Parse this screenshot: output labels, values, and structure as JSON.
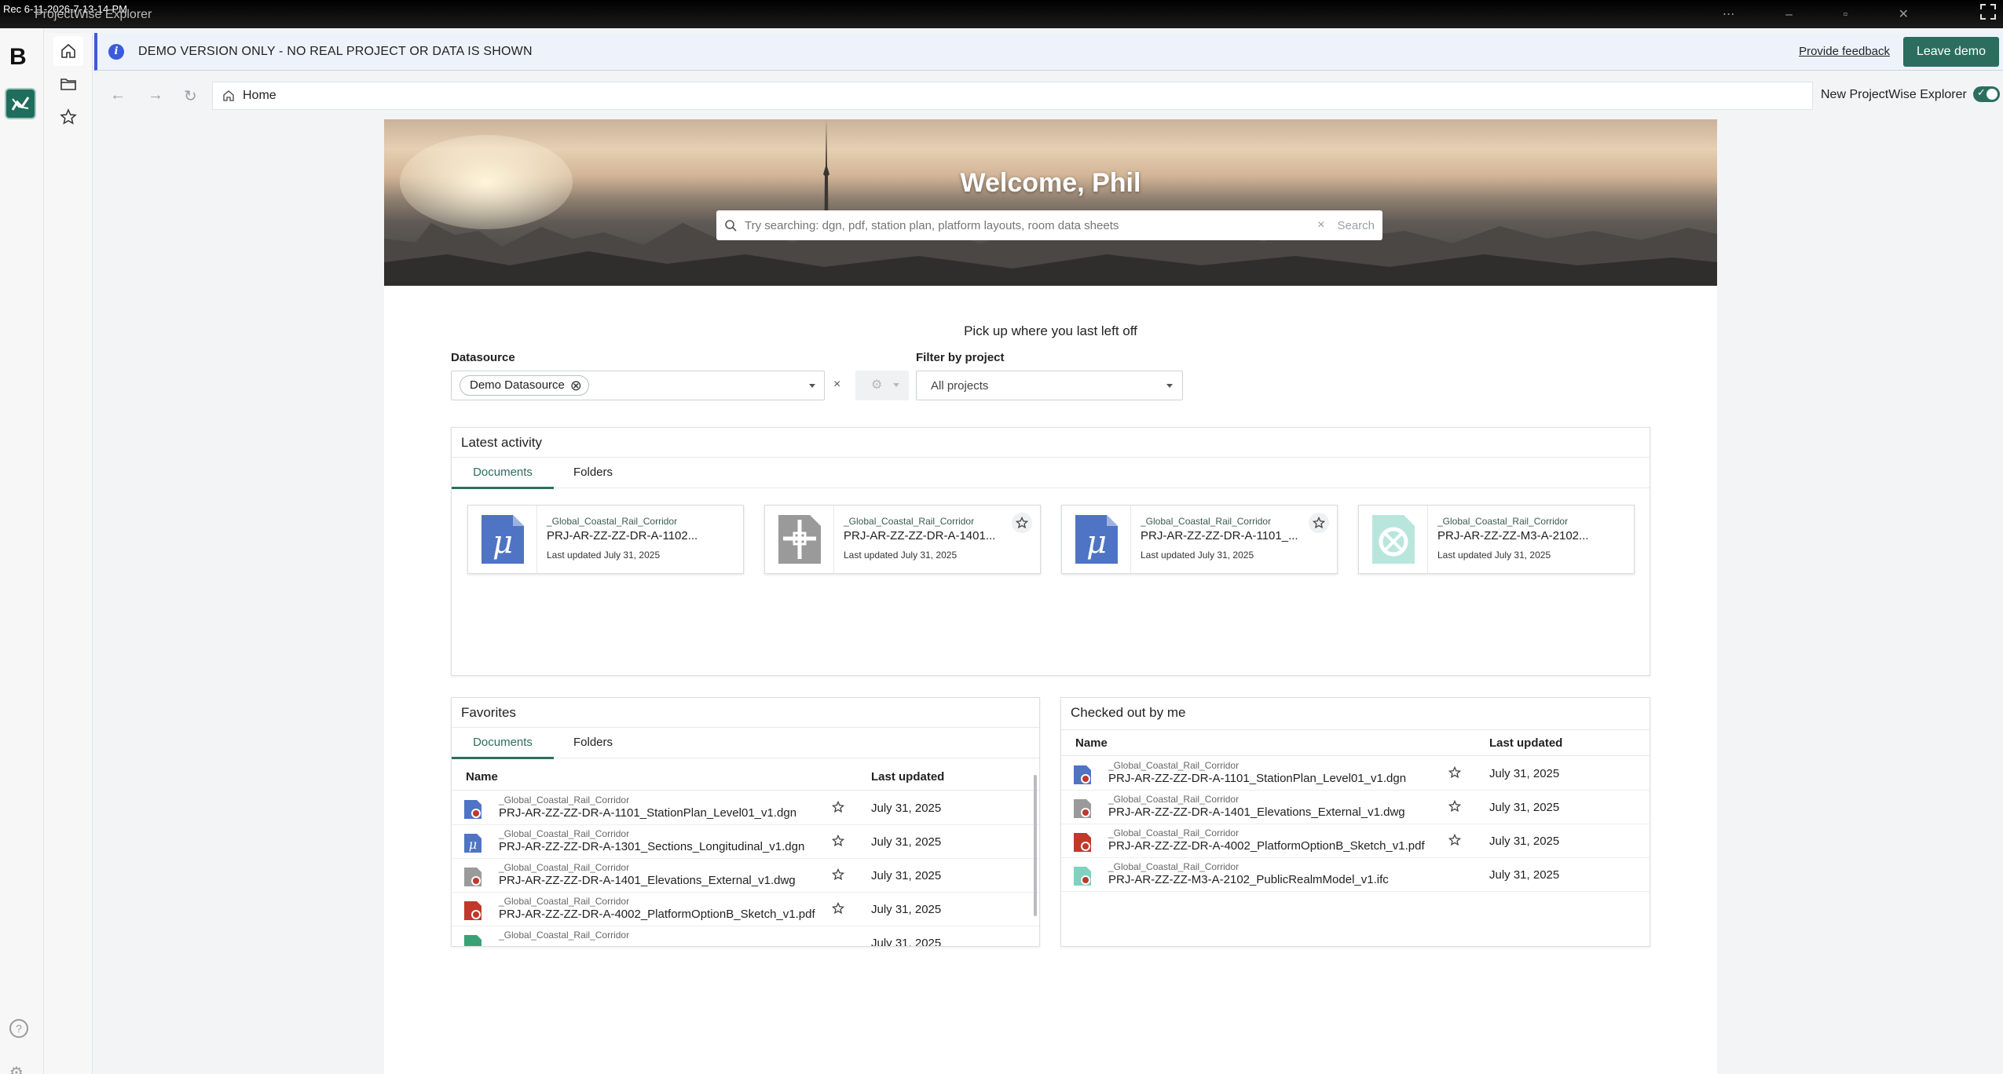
{
  "os": {
    "recording_label": "Rec 6-11-2026-7-13-14-PM",
    "window_title": "ProjectWise Explorer"
  },
  "rail": {
    "logo": "B"
  },
  "banner": {
    "message": "DEMO VERSION ONLY - NO REAL PROJECT OR DATA IS SHOWN",
    "feedback_link": "Provide feedback",
    "leave_button": "Leave demo"
  },
  "address": {
    "crumb": "Home",
    "new_explorer_label": "New ProjectWise Explorer",
    "new_explorer_on": true
  },
  "hero": {
    "welcome": "Welcome, Phil",
    "search_placeholder": "Try searching: dgn, pdf, station plan, platform layouts, room data sheets",
    "search_button": "Search"
  },
  "pickup_text": "Pick up where you last left off",
  "filters": {
    "datasource_label": "Datasource",
    "datasource_chip": "Demo Datasource",
    "project_label": "Filter by project",
    "project_value": "All projects"
  },
  "latest": {
    "title": "Latest activity",
    "tabs": [
      "Documents",
      "Folders"
    ],
    "cards": [
      {
        "path": "_Global_Coastal_Rail_Corridor",
        "name": "PRJ-AR-ZZ-ZZ-DR-A-1102...",
        "date": "Last updated July 31, 2025",
        "icon": "microstation-icon"
      },
      {
        "path": "_Global_Coastal_Rail_Corridor",
        "name": "PRJ-AR-ZZ-ZZ-DR-A-1401...",
        "date": "Last updated July 31, 2025",
        "icon": "dwg-icon"
      },
      {
        "path": "_Global_Coastal_Rail_Corridor",
        "name": "PRJ-AR-ZZ-ZZ-DR-A-1101_...",
        "date": "Last updated July 31, 2025",
        "icon": "microstation-icon"
      },
      {
        "path": "_Global_Coastal_Rail_Corridor",
        "name": "PRJ-AR-ZZ-ZZ-M3-A-2102...",
        "date": "Last updated July 31, 2025",
        "icon": "ifc-icon"
      }
    ]
  },
  "favorites": {
    "title": "Favorites",
    "tabs": [
      "Documents",
      "Folders"
    ],
    "col_name": "Name",
    "col_updated": "Last updated",
    "rows": [
      {
        "path": "_Global_Coastal_Rail_Corridor",
        "name": "PRJ-AR-ZZ-ZZ-DR-A-1101_StationPlan_Level01_v1.dgn",
        "date": "July 31, 2025",
        "icon": "dgn-checked-icon"
      },
      {
        "path": "_Global_Coastal_Rail_Corridor",
        "name": "PRJ-AR-ZZ-ZZ-DR-A-1301_Sections_Longitudinal_v1.dgn",
        "date": "July 31, 2025",
        "icon": "microstation-icon"
      },
      {
        "path": "_Global_Coastal_Rail_Corridor",
        "name": "PRJ-AR-ZZ-ZZ-DR-A-1401_Elevations_External_v1.dwg",
        "date": "July 31, 2025",
        "icon": "dwg-checked-icon"
      },
      {
        "path": "_Global_Coastal_Rail_Corridor",
        "name": "PRJ-AR-ZZ-ZZ-DR-A-4002_PlatformOptionB_Sketch_v1.pdf",
        "date": "July 31, 2025",
        "icon": "pdf-checked-icon"
      },
      {
        "path": "_Global_Coastal_Rail_Corridor",
        "name": "",
        "date": "July 31, 2025",
        "icon": "ifc-icon"
      }
    ]
  },
  "checked_out": {
    "title": "Checked out by me",
    "col_name": "Name",
    "col_updated": "Last updated",
    "rows": [
      {
        "path": "_Global_Coastal_Rail_Corridor",
        "name": "PRJ-AR-ZZ-ZZ-DR-A-1101_StationPlan_Level01_v1.dgn",
        "date": "July 31, 2025",
        "icon": "dgn-checked-icon"
      },
      {
        "path": "_Global_Coastal_Rail_Corridor",
        "name": "PRJ-AR-ZZ-ZZ-DR-A-1401_Elevations_External_v1.dwg",
        "date": "July 31, 2025",
        "icon": "dwg-checked-icon"
      },
      {
        "path": "_Global_Coastal_Rail_Corridor",
        "name": "PRJ-AR-ZZ-ZZ-DR-A-4002_PlatformOptionB_Sketch_v1.pdf",
        "date": "July 31, 2025",
        "icon": "pdf-checked-icon"
      },
      {
        "path": "_Global_Coastal_Rail_Corridor",
        "name": "PRJ-AR-ZZ-ZZ-M3-A-2102_PublicRealmModel_v1.ifc",
        "date": "July 31, 2025",
        "icon": "ifc-checked-icon"
      }
    ]
  },
  "colors": {
    "accent": "#2b6e5e",
    "info": "#3b5bdb",
    "micro_blue": "#4f74c4",
    "pdf_red": "#c0392b",
    "ifc_teal": "#7fd1c0"
  }
}
